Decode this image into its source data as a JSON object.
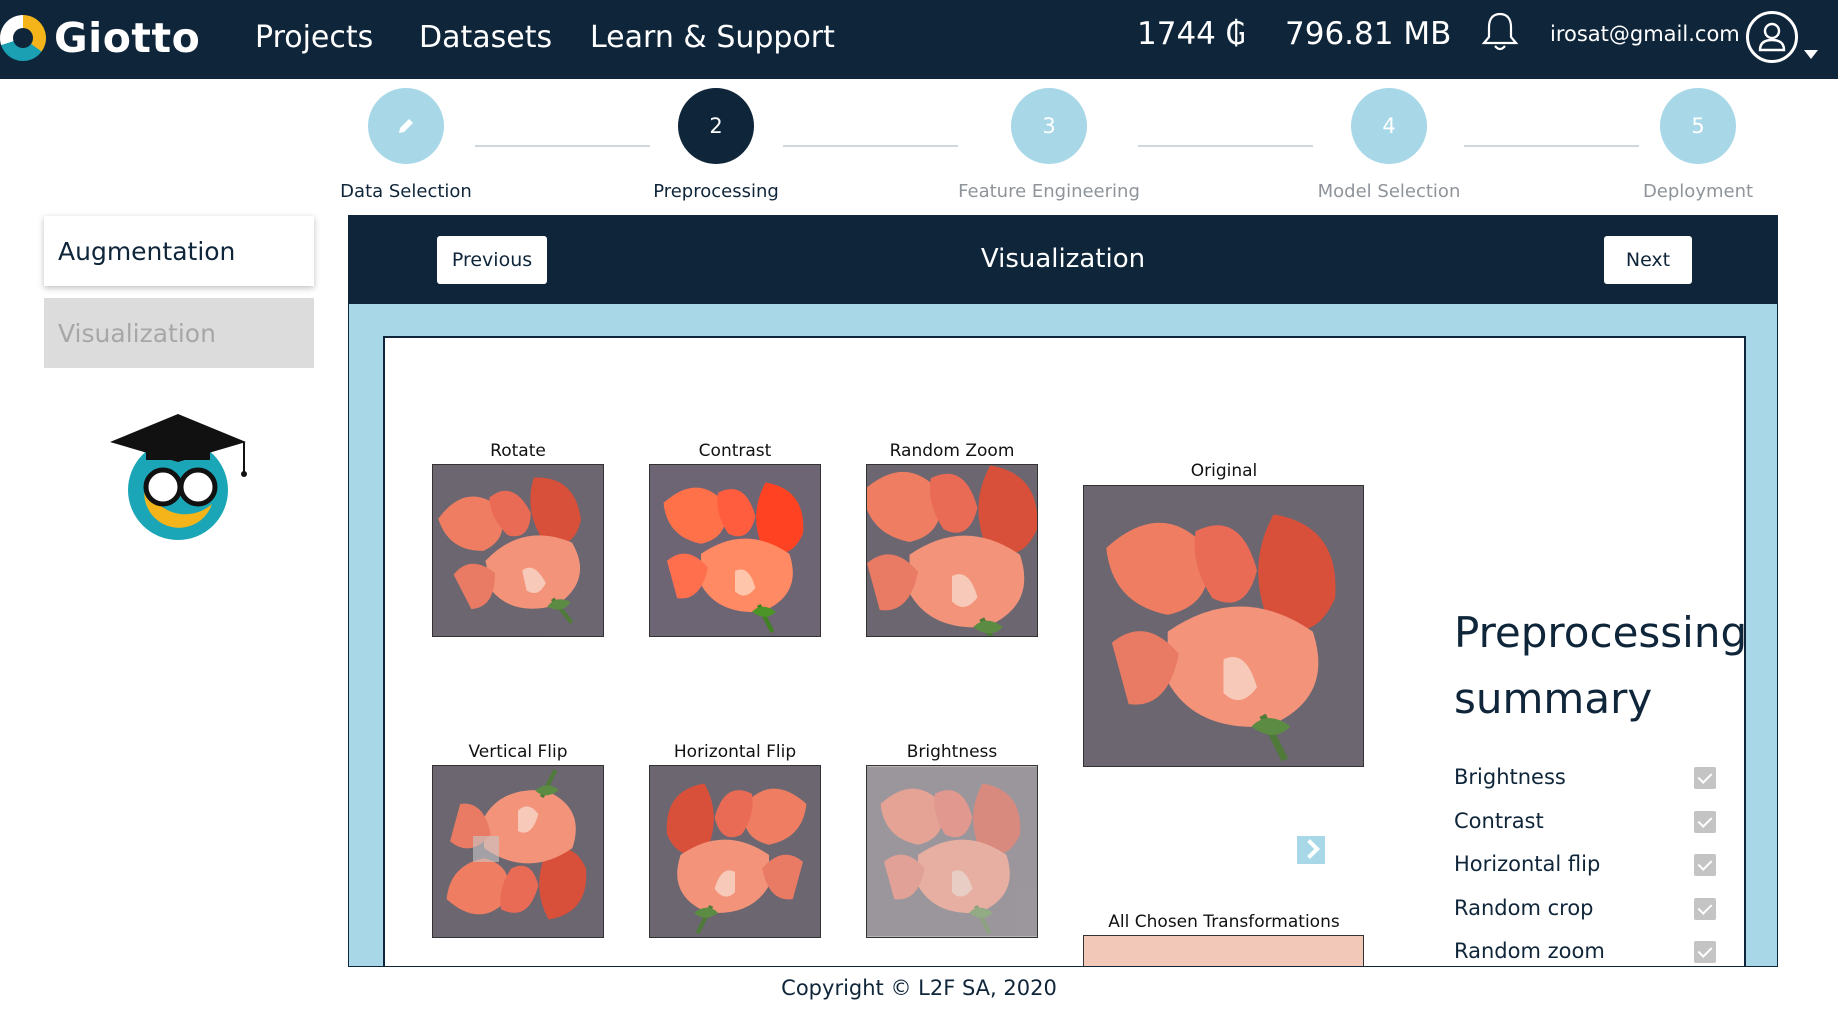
{
  "nav": {
    "brand": "Giotto",
    "links": [
      "Projects",
      "Datasets",
      "Learn & Support"
    ],
    "credits": "1744 ₲",
    "storage": "796.81 MB",
    "email": "irosat@gmail.com"
  },
  "stepper": {
    "steps": [
      {
        "number": "",
        "label": "Data Selection",
        "state": "done"
      },
      {
        "number": "2",
        "label": "Preprocessing",
        "state": "active"
      },
      {
        "number": "3",
        "label": "Feature Engineering",
        "state": "pending"
      },
      {
        "number": "4",
        "label": "Model Selection",
        "state": "pending"
      },
      {
        "number": "5",
        "label": "Deployment",
        "state": "pending"
      }
    ]
  },
  "sidebar": {
    "augmentation": "Augmentation",
    "visualization": "Visualization"
  },
  "panel": {
    "previous": "Previous",
    "title": "Visualization",
    "next": "Next"
  },
  "thumbnails": {
    "rotate": "Rotate",
    "contrast": "Contrast",
    "random_zoom": "Random Zoom",
    "original": "Original",
    "vertical_flip": "Vertical Flip",
    "horizontal_flip": "Horizontal Flip",
    "brightness": "Brightness",
    "all_chosen": "All Chosen Transformations"
  },
  "summary": {
    "title_line1": "Preprocessing",
    "title_line2": "summary",
    "items": [
      {
        "label": "Brightness",
        "checked": true
      },
      {
        "label": "Contrast",
        "checked": true
      },
      {
        "label": "Horizontal flip",
        "checked": true
      },
      {
        "label": "Random crop",
        "checked": true
      },
      {
        "label": "Random zoom",
        "checked": true
      }
    ]
  },
  "footer": {
    "copyright": "Copyright © L2F SA, 2020"
  },
  "colors": {
    "navy": "#0f253a",
    "light_blue": "#a8d8e8",
    "flower": "#f08a6a"
  }
}
